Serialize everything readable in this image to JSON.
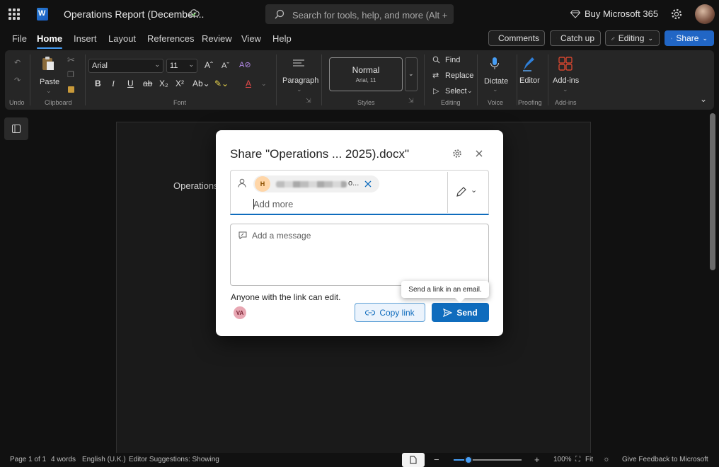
{
  "titlebar": {
    "doc_title": "Operations Report (December...",
    "search_placeholder": "Search for tools, help, and more (Alt + Q)",
    "buy_label": "Buy Microsoft 365"
  },
  "menu": {
    "tabs": [
      "File",
      "Home",
      "Insert",
      "Layout",
      "References",
      "Review",
      "View",
      "Help"
    ],
    "active_tab": "Home",
    "comments": "Comments",
    "catchup": "Catch up",
    "editing": "Editing",
    "share": "Share"
  },
  "ribbon": {
    "undo_group": "Undo",
    "paste": "Paste",
    "clipboard_group": "Clipboard",
    "font_name": "Arial",
    "font_size": "11",
    "font_group": "Font",
    "paragraph": "Paragraph",
    "style_name": "Normal",
    "style_sub": "Arial, 11",
    "styles_group": "Styles",
    "find": "Find",
    "replace": "Replace",
    "select": "Select",
    "editing_group": "Editing",
    "dictate": "Dictate",
    "voice_group": "Voice",
    "editor": "Editor",
    "proofing_group": "Proofing",
    "addins": "Add-ins",
    "addins_group": "Add-ins"
  },
  "document": {
    "body_text": "Operations"
  },
  "dialog": {
    "title": "Share \"Operations ... 2025).docx\"",
    "recipient_initial": "H",
    "recipient_trail": "o...",
    "add_more_placeholder": "Add more",
    "message_placeholder": "Add a message",
    "link_setting": "Anyone with the link can edit.",
    "owner_initials": "VA",
    "copy_link": "Copy link",
    "send": "Send",
    "tooltip": "Send a link in an email."
  },
  "statusbar": {
    "page": "Page 1 of 1",
    "words": "4 words",
    "language": "English (U.K.)",
    "suggestions": "Editor Suggestions: Showing",
    "zoom_minus": "−",
    "zoom_plus": "+",
    "zoom": "100%",
    "fit": "Fit",
    "feedback": "Give Feedback to Microsoft"
  },
  "colors": {
    "accent": "#0f6cbd",
    "share_button": "#2166c5",
    "background": "#111111"
  },
  "icons": [
    "app-launcher-icon",
    "word-logo-icon",
    "cloud-saved-icon",
    "search-icon",
    "diamond-icon",
    "gear-icon",
    "settings-icon",
    "close-icon",
    "person-icon",
    "pencil-icon",
    "message-icon",
    "link-icon",
    "send-icon"
  ]
}
